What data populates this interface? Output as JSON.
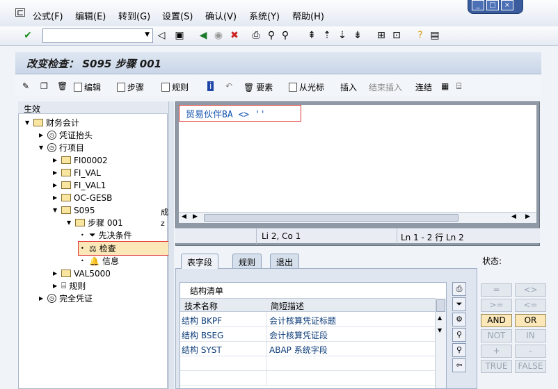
{
  "menu": [
    "公式(F)",
    "编辑(E)",
    "转到(G)",
    "设置(S)",
    "确认(V)",
    "系统(Y)",
    "帮助(H)"
  ],
  "window_controls": [
    "_",
    "□",
    "×"
  ],
  "title": "改变检查： S095 步骤 001",
  "app_toolbar": {
    "btn_1": "编辑",
    "btn_2": "步骤",
    "btn_3": "规则",
    "btn_4": "要素",
    "btn_5": "从光标",
    "btn_6": "插入",
    "btn_7": "结束插入",
    "btn_8": "连结"
  },
  "tree": {
    "header": "生效",
    "nodes": [
      {
        "label": "财务会计"
      },
      {
        "label": "凭证抬头"
      },
      {
        "label": "行项目"
      },
      {
        "label": "FI00002"
      },
      {
        "label": "FI_VAL"
      },
      {
        "label": "FI_VAL1"
      },
      {
        "label": "OC-GESB"
      },
      {
        "label": "S095"
      },
      {
        "label": "步骤 001"
      },
      {
        "label": "先决条件"
      },
      {
        "label": "检查"
      },
      {
        "label": "信息"
      },
      {
        "label": "VAL5000"
      },
      {
        "label": "规则"
      },
      {
        "label": "完全凭证"
      }
    ],
    "side_marks": [
      "成",
      "z"
    ]
  },
  "editor": {
    "code": "贸易伙伴BA <> ''",
    "position": "Li 2, Co 1",
    "lines": "Ln 1 - 2 行 Ln 2"
  },
  "tabs": [
    "表字段",
    "规则",
    "退出"
  ],
  "status_label": "状态:",
  "field_table": {
    "title": "结构清单",
    "col1": "技术名称",
    "col2": "简短描述",
    "rows": [
      {
        "name": "结构 BKPF",
        "desc": "会计核算凭证标题"
      },
      {
        "name": "结构 BSEG",
        "desc": "会计核算凭证段"
      },
      {
        "name": "结构 SYST",
        "desc": "ABAP 系统字段"
      }
    ]
  },
  "operators": [
    "=",
    "<>",
    ">=",
    "<=",
    "AND",
    "OR",
    "NOT",
    "IN",
    "+",
    "-",
    "TRUE",
    "FALSE"
  ]
}
